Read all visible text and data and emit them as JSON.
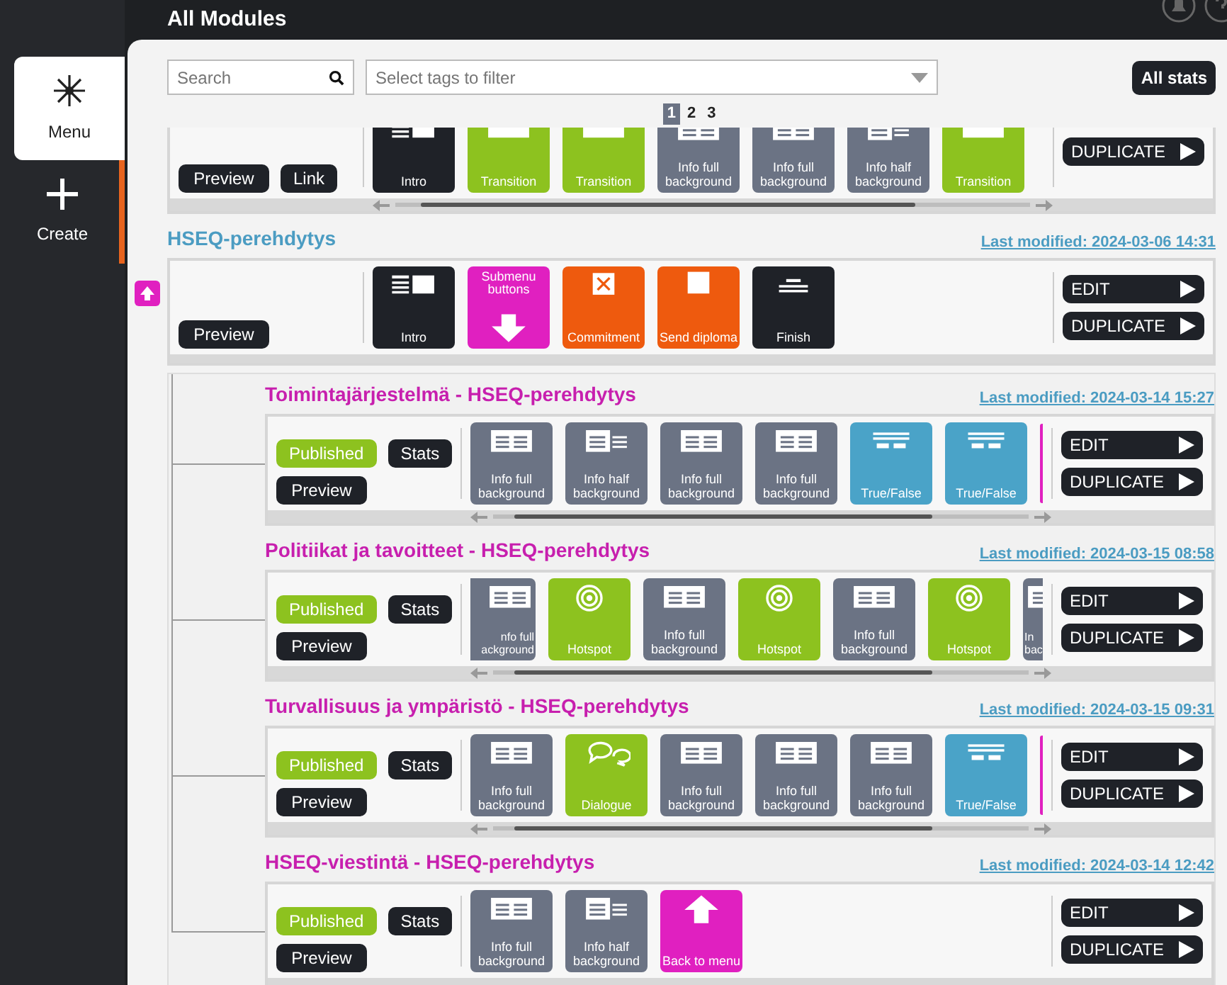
{
  "header": {
    "title": "All Modules"
  },
  "sidebar": {
    "items": [
      {
        "kind": "menu",
        "label": "Menu",
        "selected": true,
        "highlighted": false
      },
      {
        "kind": "create",
        "label": "Create",
        "selected": false,
        "highlighted": true
      }
    ]
  },
  "filters": {
    "search": {
      "placeholder": "Search"
    },
    "tags": {
      "placeholder": "Select tags to filter"
    },
    "all_stats": "All stats"
  },
  "pagination": [
    {
      "label": "1",
      "selected": true
    },
    {
      "label": "2",
      "selected": false
    },
    {
      "label": "3",
      "selected": false
    }
  ],
  "modules": [
    {
      "scrolled_past": true,
      "rows": [
        [
          {
            "kind": "preview",
            "label": "Preview"
          },
          {
            "kind": "link",
            "label": "Link"
          }
        ]
      ],
      "slides": [
        {
          "kind": "intro",
          "label": "Intro"
        },
        {
          "kind": "transition",
          "label": "Transition"
        },
        {
          "kind": "transition",
          "label": "Transition"
        },
        {
          "kind": "info-full",
          "label": "Info full background"
        },
        {
          "kind": "info-full",
          "label": "Info full background"
        },
        {
          "kind": "info-half",
          "label": "Info half background"
        },
        {
          "kind": "transition",
          "label": "Transition"
        }
      ],
      "scrollbar": true,
      "actions": [
        "DUPLICATE"
      ]
    },
    {
      "title": "HSEQ-perehdytys",
      "last_modified": "Last modified: 2024-03-06 14:31",
      "expanded": true,
      "rows": [
        [
          {
            "kind": "preview",
            "label": "Preview"
          }
        ]
      ],
      "slides": [
        {
          "kind": "intro",
          "label": "Intro"
        },
        {
          "kind": "submenu",
          "label": "Submenu buttons"
        },
        {
          "kind": "commitment",
          "label": "Commitment"
        },
        {
          "kind": "diploma",
          "label": "Send diploma"
        },
        {
          "kind": "finish",
          "label": "Finish"
        }
      ],
      "actions": [
        "EDIT",
        "DUPLICATE"
      ],
      "children": [
        {
          "title": "Toimintajärjestelmä - HSEQ-perehdytys",
          "last_modified": "Last modified: 2024-03-14 15:27",
          "rows": [
            [
              {
                "kind": "published",
                "label": "Published"
              },
              {
                "kind": "stats",
                "label": "Stats"
              }
            ],
            [
              {
                "kind": "preview",
                "label": "Preview"
              }
            ]
          ],
          "slides": [
            {
              "kind": "info-full",
              "label": "Info full background"
            },
            {
              "kind": "info-half",
              "label": "Info half background"
            },
            {
              "kind": "info-full",
              "label": "Info full background"
            },
            {
              "kind": "info-full",
              "label": "Info full background"
            },
            {
              "kind": "true-false",
              "label": "True/False"
            },
            {
              "kind": "true-false",
              "label": "True/False"
            }
          ],
          "end_marker": true,
          "scrollbar": true,
          "actions": [
            "EDIT",
            "DUPLICATE"
          ]
        },
        {
          "title": "Politiikat ja tavoitteet - HSEQ-perehdytys",
          "last_modified": "Last modified: 2024-03-15 08:58",
          "rows": [
            [
              {
                "kind": "published",
                "label": "Published"
              },
              {
                "kind": "stats",
                "label": "Stats"
              }
            ],
            [
              {
                "kind": "preview",
                "label": "Preview"
              }
            ]
          ],
          "slides": [
            {
              "kind": "info-full",
              "label": "nfo full ackground",
              "cut_left": true
            },
            {
              "kind": "hotspot",
              "label": "Hotspot"
            },
            {
              "kind": "info-full",
              "label": "Info full background"
            },
            {
              "kind": "hotspot",
              "label": "Hotspot"
            },
            {
              "kind": "info-full",
              "label": "Info full background"
            },
            {
              "kind": "hotspot",
              "label": "Hotspot"
            },
            {
              "kind": "info-full",
              "label": "In bac",
              "cut_right": true
            }
          ],
          "scrollbar": true,
          "actions": [
            "EDIT",
            "DUPLICATE"
          ]
        },
        {
          "title": "Turvallisuus ja ympäristö - HSEQ-perehdytys",
          "last_modified": "Last modified: 2024-03-15 09:31",
          "rows": [
            [
              {
                "kind": "published",
                "label": "Published"
              },
              {
                "kind": "stats",
                "label": "Stats"
              }
            ],
            [
              {
                "kind": "preview",
                "label": "Preview"
              }
            ]
          ],
          "slides": [
            {
              "kind": "info-full",
              "label": "Info full background"
            },
            {
              "kind": "dialogue",
              "label": "Dialogue"
            },
            {
              "kind": "info-full",
              "label": "Info full background"
            },
            {
              "kind": "info-full",
              "label": "Info full background"
            },
            {
              "kind": "info-full",
              "label": "Info full background"
            },
            {
              "kind": "true-false",
              "label": "True/False"
            }
          ],
          "end_marker": true,
          "scrollbar": true,
          "actions": [
            "EDIT",
            "DUPLICATE"
          ]
        },
        {
          "title": "HSEQ-viestintä - HSEQ-perehdytys",
          "last_modified": "Last modified: 2024-03-14 12:42",
          "rows": [
            [
              {
                "kind": "published",
                "label": "Published"
              },
              {
                "kind": "stats",
                "label": "Stats"
              }
            ],
            [
              {
                "kind": "preview",
                "label": "Preview"
              }
            ]
          ],
          "slides": [
            {
              "kind": "info-full",
              "label": "Info full background"
            },
            {
              "kind": "info-half",
              "label": "Info half background"
            },
            {
              "kind": "back",
              "label": "Back to menu"
            }
          ],
          "actions": [
            "EDIT",
            "DUPLICATE"
          ]
        }
      ]
    }
  ]
}
